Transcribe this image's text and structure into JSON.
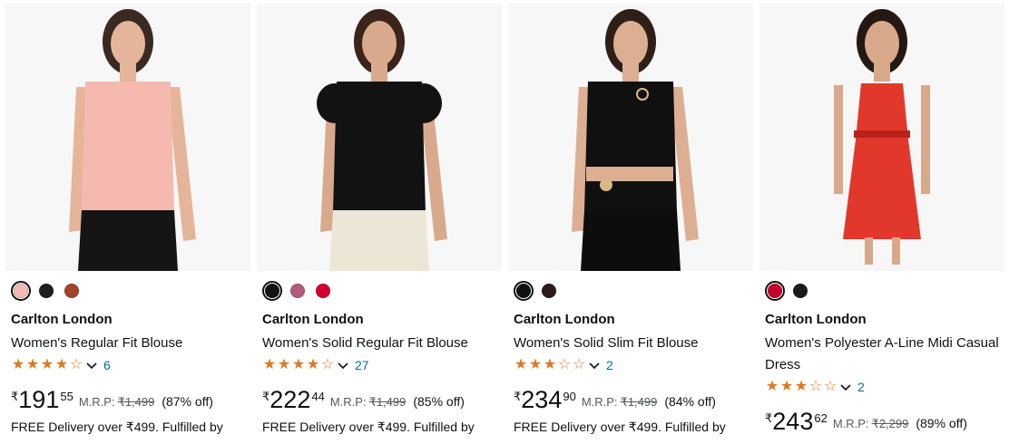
{
  "products": [
    {
      "brand": "Carlton London",
      "title": "Women's Regular Fit Blouse",
      "rating": 4,
      "reviews": "6",
      "currency": "₹",
      "price_whole": "191",
      "price_fraction": "55",
      "mrp_label": "M.R.P:",
      "mrp": "₹1,499",
      "discount": "(87% off)",
      "delivery": "FREE Delivery over ₹499. Fulfilled by",
      "swatches": [
        {
          "color": "#f3b9b4",
          "selected": true
        },
        {
          "color": "#1f1f1f",
          "selected": false
        },
        {
          "color": "#a0452a",
          "selected": false
        }
      ],
      "image": {
        "top": "#f6b9b0",
        "bottom": "#151515",
        "skin": "#e4b59a",
        "hair": "#3a2a22"
      }
    },
    {
      "brand": "Carlton London",
      "title": "Women's Solid Regular Fit Blouse",
      "rating": 4,
      "reviews": "27",
      "currency": "₹",
      "price_whole": "222",
      "price_fraction": "44",
      "mrp_label": "M.R.P:",
      "mrp": "₹1,499",
      "discount": "(85% off)",
      "delivery": "FREE Delivery over ₹499. Fulfilled by",
      "swatches": [
        {
          "color": "#111111",
          "selected": true
        },
        {
          "color": "#b35a7a",
          "selected": false
        },
        {
          "color": "#d1002c",
          "selected": false
        }
      ],
      "image": {
        "top": "#121212",
        "bottom": "#ece6d6",
        "skin": "#d9a98e",
        "hair": "#3b241b"
      }
    },
    {
      "brand": "Carlton London",
      "title": "Women's Solid Slim Fit Blouse",
      "rating": 3,
      "reviews": "2",
      "currency": "₹",
      "price_whole": "234",
      "price_fraction": "90",
      "mrp_label": "M.R.P:",
      "mrp": "₹1,499",
      "discount": "(84% off)",
      "delivery": "FREE Delivery over ₹499. Fulfilled by",
      "swatches": [
        {
          "color": "#111111",
          "selected": true
        },
        {
          "color": "#2b1a1e",
          "selected": false
        }
      ],
      "image": {
        "top": "#101010",
        "bottom": "#0d0d0d",
        "skin": "#dcae92",
        "hair": "#2e1f18"
      }
    },
    {
      "brand": "Carlton London",
      "title": "Women's Polyester A-Line Midi Casual Dress",
      "rating": 3,
      "reviews": "2",
      "currency": "₹",
      "price_whole": "243",
      "price_fraction": "62",
      "mrp_label": "M.R.P:",
      "mrp": "₹2,299",
      "discount": "(89% off)",
      "delivery": "",
      "swatches": [
        {
          "color": "#c4002a",
          "selected": true
        },
        {
          "color": "#1a1a1a",
          "selected": false
        }
      ],
      "image": {
        "top": "#e2382b",
        "bottom": "#e2382b",
        "skin": "#d8a88a",
        "hair": "#241813"
      }
    }
  ]
}
